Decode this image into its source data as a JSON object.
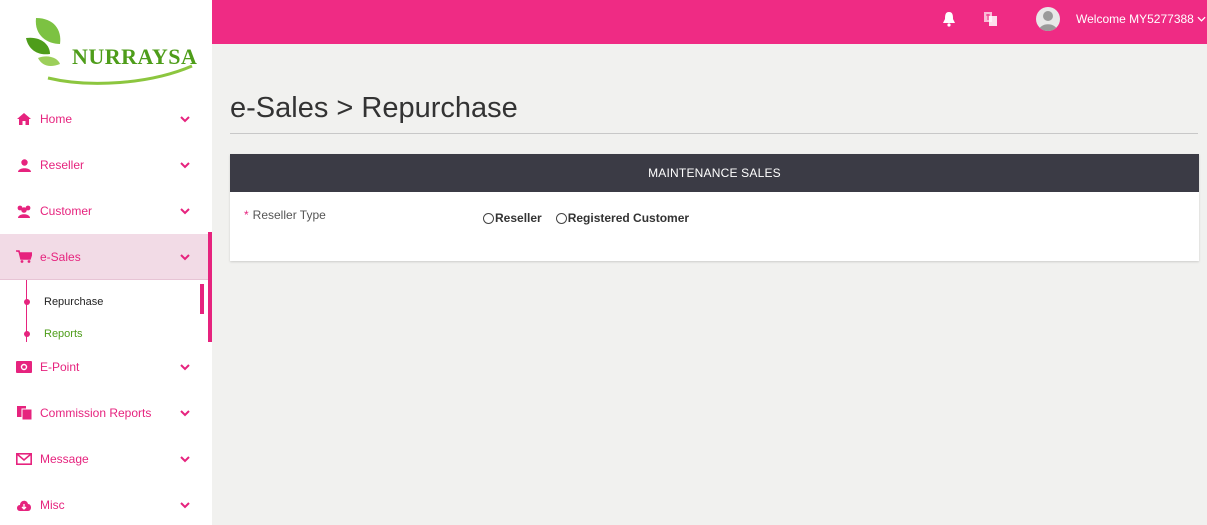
{
  "brand": {
    "name": "NURRAYSA",
    "trademark": "®"
  },
  "topbar": {
    "welcome": "Welcome MY5277388",
    "icons": [
      "bell-icon",
      "language-icon",
      "user-avatar-icon",
      "chevron-down-icon"
    ],
    "background": "#ef2b84"
  },
  "sidebar": {
    "accent": "#e6237e",
    "items": [
      {
        "label": "Home",
        "icon": "home-icon"
      },
      {
        "label": "Reseller",
        "icon": "user-icon"
      },
      {
        "label": "Customer",
        "icon": "users-icon"
      },
      {
        "label": "e-Sales",
        "icon": "cart-icon",
        "expanded": true
      },
      {
        "label": "E-Point",
        "icon": "money-icon"
      },
      {
        "label": "Commission Reports",
        "icon": "files-icon"
      },
      {
        "label": "Message",
        "icon": "envelope-icon"
      },
      {
        "label": "Misc",
        "icon": "cloud-download-icon"
      }
    ],
    "esales_sub": [
      {
        "label": "Repurchase",
        "active": true
      },
      {
        "label": "Reports",
        "color": "#4e9d1a"
      }
    ]
  },
  "main": {
    "title": "e-Sales > Repurchase",
    "panel": {
      "heading": "MAINTENANCE SALES",
      "field_label": "Reseller Type",
      "required_mark": "*",
      "options": [
        "Reseller",
        "Registered Customer"
      ]
    }
  }
}
